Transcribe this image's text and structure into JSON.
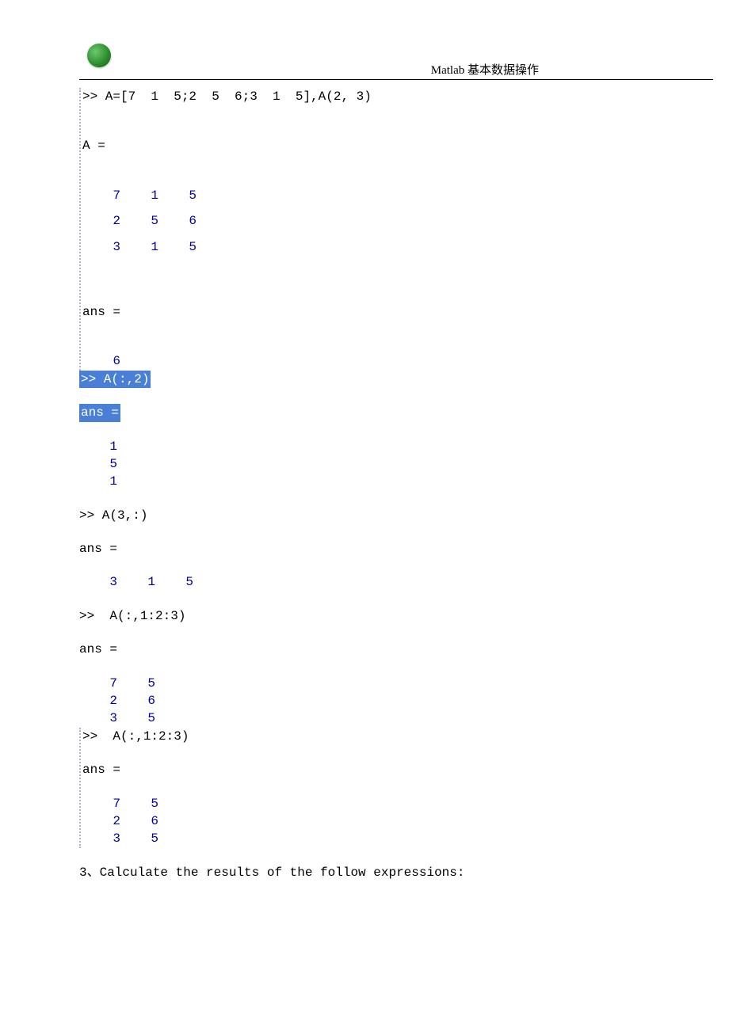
{
  "header": {
    "title": "Matlab 基本数据操作"
  },
  "block1": {
    "cmd": ">> A=[7  1  5;2  5  6;3  1  5],A(2, 3)",
    "varA": "A =",
    "matrixA": [
      [
        "7",
        "1",
        "5"
      ],
      [
        "2",
        "5",
        "6"
      ],
      [
        "3",
        "1",
        "5"
      ]
    ],
    "ans_label": "ans =",
    "ans_val": "6"
  },
  "block2": {
    "cmd_hl": ">> A(:,2)",
    "ans_hl": "ans =",
    "col": [
      "1",
      "5",
      "1"
    ]
  },
  "block3": {
    "cmd": ">> A(3,:)",
    "ans_label": "ans =",
    "row": [
      "3",
      "1",
      "5"
    ]
  },
  "block4": {
    "cmd": ">>  A(:,1:2:3)",
    "ans_label": "ans =",
    "matrix": [
      [
        "7",
        "5"
      ],
      [
        "2",
        "6"
      ],
      [
        "3",
        "5"
      ]
    ]
  },
  "block5": {
    "cmd": ">>  A(:,1:2:3)",
    "ans_label": "ans =",
    "matrix": [
      [
        "7",
        "5"
      ],
      [
        "2",
        "6"
      ],
      [
        "3",
        "5"
      ]
    ]
  },
  "section3": "3、Calculate the results of the follow expressions:"
}
